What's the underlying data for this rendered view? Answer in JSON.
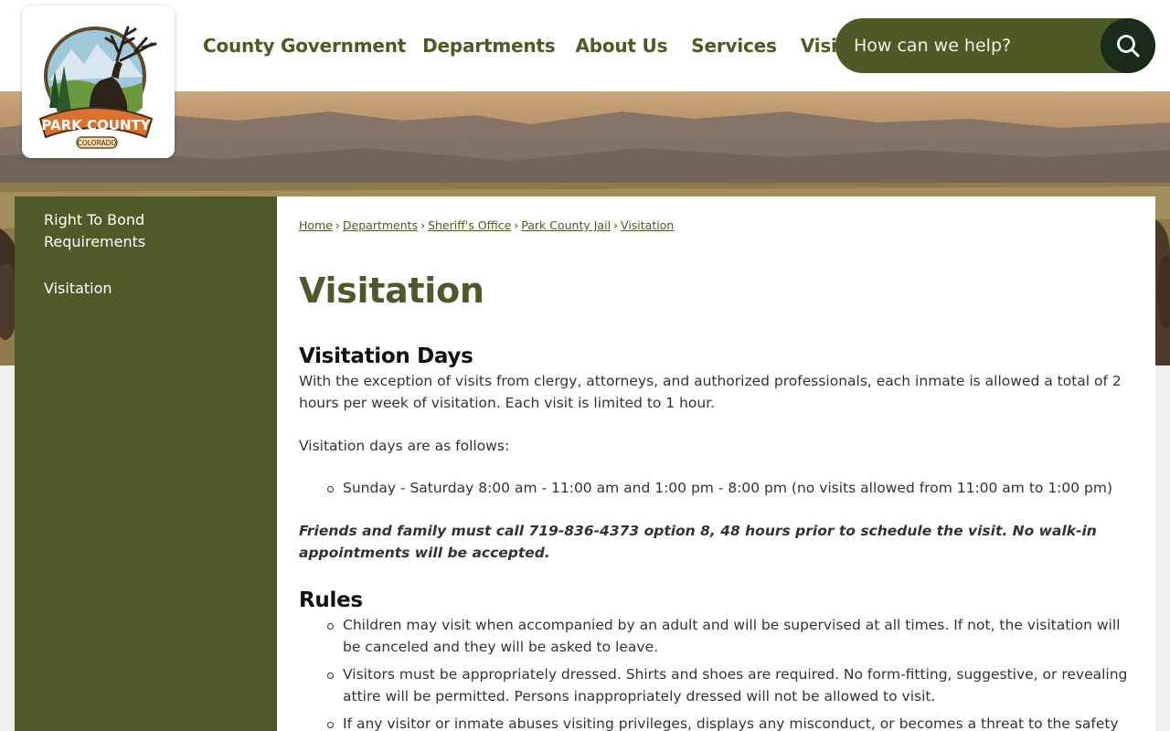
{
  "logo": {
    "name": "PARK COUNTY",
    "sub": "COLORADO"
  },
  "nav": {
    "items": [
      "County Government",
      "Departments",
      "About Us",
      "Services",
      "Visitors"
    ]
  },
  "search": {
    "placeholder": "How can we help?",
    "icon": "search-icon"
  },
  "sidebar": {
    "items": [
      {
        "label": "Right To Bond Requirements"
      },
      {
        "label": "Visitation"
      }
    ]
  },
  "breadcrumb": [
    "Home",
    "Departments",
    "Sheriff's Office",
    "Park County Jail",
    "Visitation"
  ],
  "page_title": "Visitation",
  "sections": {
    "visitation_days": {
      "heading": "Visitation Days",
      "intro": "With the exception of visits from clergy, attorneys, and authorized professionals, each inmate is allowed a total of 2 hours per week of visitation. Each visit is limited to 1 hour.",
      "days_label": "Visitation days are as follows:",
      "days": [
        "Sunday - Saturday 8:00 am - 11:00 am and 1:00 pm - 8:00 pm (no visits allowed from 11:00 am to 1:00 pm)"
      ],
      "notice": "Friends and family must call 719-836-4373 option 8, 48 hours prior to schedule the visit.  No walk-in appointments will be accepted."
    },
    "rules": {
      "heading": "Rules",
      "items": [
        "Children may visit when accompanied by an adult and will be supervised at all times. If not, the visitation will be canceled and they will be asked to leave.",
        "Visitors must be appropriately dressed. Shirts and shoes are required. No form-fitting, suggestive, or revealing attire will be permitted. Persons inappropriately dressed will not be allowed to visit.",
        "If any visitor or inmate abuses visiting privileges, displays any misconduct, or becomes a threat to the safety and"
      ]
    }
  },
  "colors": {
    "olive": "#4e5b28",
    "title_olive": "#4c5a29",
    "search_bg": "#4c5a25",
    "search_btn": "#1a2b1a"
  }
}
